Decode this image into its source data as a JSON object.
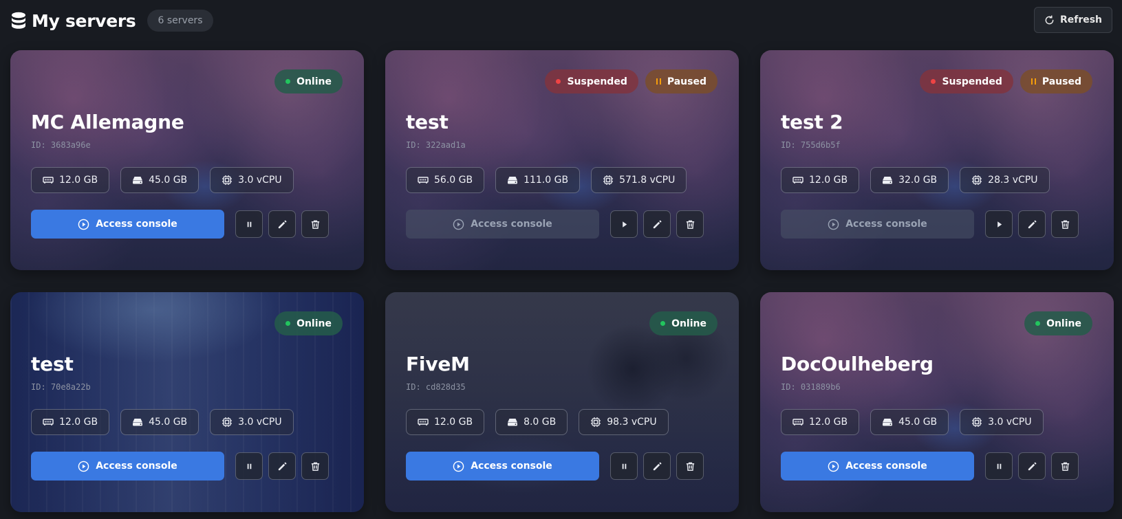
{
  "header": {
    "title": "My servers",
    "server_count": "6 servers",
    "refresh_label": "Refresh"
  },
  "colors": {
    "accent": "#3a79e2",
    "online": "#22c55e",
    "suspended": "#ef4444",
    "paused": "#f59e0b",
    "background": "#181b21"
  },
  "servers": [
    {
      "name": "MC Allemagne",
      "id": "ID: 3683a96e",
      "background": "flowers",
      "badges": [
        {
          "label": "Online",
          "kind": "online"
        }
      ],
      "ram": "12.0 GB",
      "disk": "45.0 GB",
      "cpu": "3.0 vCPU",
      "console_label": "Access console",
      "console_enabled": true,
      "power_action": "pause"
    },
    {
      "name": "test",
      "id": "ID: 322aad1a",
      "background": "flowers",
      "badges": [
        {
          "label": "Suspended",
          "kind": "suspended"
        },
        {
          "label": "Paused",
          "kind": "paused"
        }
      ],
      "ram": "56.0 GB",
      "disk": "111.0 GB",
      "cpu": "571.8 vCPU",
      "console_label": "Access console",
      "console_enabled": false,
      "power_action": "play"
    },
    {
      "name": "test 2",
      "id": "ID: 755d6b5f",
      "background": "flowers",
      "badges": [
        {
          "label": "Suspended",
          "kind": "suspended"
        },
        {
          "label": "Paused",
          "kind": "paused"
        }
      ],
      "ram": "12.0 GB",
      "disk": "32.0 GB",
      "cpu": "28.3 vCPU",
      "console_label": "Access console",
      "console_enabled": false,
      "power_action": "play"
    },
    {
      "name": "test",
      "id": "ID: 70e8a22b",
      "background": "datacenter",
      "badges": [
        {
          "label": "Online",
          "kind": "online"
        }
      ],
      "ram": "12.0 GB",
      "disk": "45.0 GB",
      "cpu": "3.0 vCPU",
      "console_label": "Access console",
      "console_enabled": true,
      "power_action": "pause"
    },
    {
      "name": "FiveM",
      "id": "ID: cd828d35",
      "background": "street",
      "badges": [
        {
          "label": "Online",
          "kind": "online"
        }
      ],
      "ram": "12.0 GB",
      "disk": "8.0 GB",
      "cpu": "98.3 vCPU",
      "console_label": "Access console",
      "console_enabled": true,
      "power_action": "pause"
    },
    {
      "name": "DocOulheberg",
      "id": "ID: 031889b6",
      "background": "flowers",
      "badges": [
        {
          "label": "Online",
          "kind": "online"
        }
      ],
      "ram": "12.0 GB",
      "disk": "45.0 GB",
      "cpu": "3.0 vCPU",
      "console_label": "Access console",
      "console_enabled": true,
      "power_action": "pause"
    }
  ]
}
